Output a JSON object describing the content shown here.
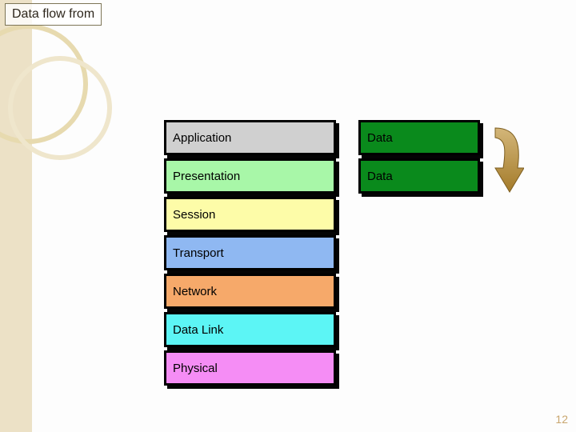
{
  "title": "Data flow from",
  "stack": {
    "application": "Application",
    "presentation": "Presentation",
    "session": "Session",
    "transport": "Transport",
    "network": "Network",
    "datalink": "Data Link",
    "physical": "Physical"
  },
  "payload": {
    "application_data": "Data",
    "presentation_data": "Data"
  },
  "colors": {
    "application": "#d0d0d0",
    "presentation": "#a8f7a8",
    "session": "#fdfca8",
    "transport": "#8fb8f2",
    "network": "#f6a96a",
    "datalink": "#5cf5f5",
    "physical": "#f58df5",
    "data_block": "#0a8a1c",
    "arrow": "#a87f2f"
  },
  "icons": {
    "flow_arrow": "curved-down-arrow-icon"
  },
  "page_number": "12"
}
